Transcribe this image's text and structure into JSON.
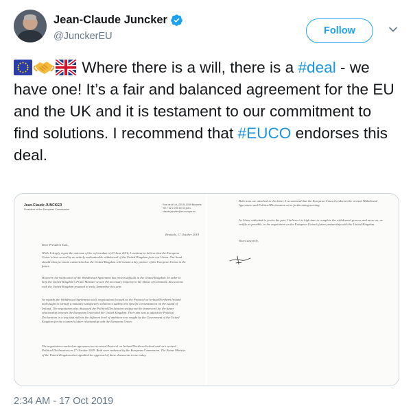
{
  "author": {
    "display_name": "Jean-Claude Juncker",
    "handle": "@JunckerEU",
    "verified": true,
    "avatar_icon": "user-avatar"
  },
  "follow_button": {
    "label": "Follow"
  },
  "menu_icon": "chevron-down-icon",
  "tweet": {
    "emojis": [
      "eu-flag",
      "handshake",
      "uk-flag"
    ],
    "text_1": " Where there is a will, there is a ",
    "hashtag_deal": "#deal",
    "text_2": " - we have one! It’s a fair and balanced agreement for the EU and the UK and it is testament to our commitment to find solutions. I recommend that ",
    "hashtag_euco": "#EUCO",
    "text_3": " endorses this deal."
  },
  "media": {
    "letter_left": {
      "sender": "Jean-Claude JUNCKER",
      "sender_title": "President of the European Commission",
      "address": "Rue de la Loi, 200 B-1049 Brussels Tel. +32 2 295 50 33 jean-claude.juncker@ec.europa.eu",
      "date": "Brussels, 17 October 2019",
      "salutation": "Dear President Tusk,",
      "paragraphs": [
        "While I deeply regret the outcome of the referendum of 23 June 2016, I continue to believe that the European Union is best served by an orderly and amicable withdrawal of the United Kingdom from our Union. Our hand should always remain outstretched as the United Kingdom will remain a key partner of the European Union in the future.",
        "However, the ratification of the Withdrawal Agreement has proven difficult in the United Kingdom. In order to help the United Kingdom’s Prime Minister secure the necessary majority in the House of Commons, discussions with the United Kingdom resumed in early September this year.",
        "As regards the Withdrawal Agreement itself, negotiations focused on the Protocol on Ireland/Northern Ireland and sought to identify a mutually satisfactory solution to address the specific circumstances on the island of Ireland. The negotiators also discussed the Political Declaration setting out the framework for the future relationship between the European Union and the United Kingdom. Their aim was to adjust the Political Declaration in a way that reflects the different level of ambition now sought by the Government of the United Kingdom for the country’s future relationship with the European Union.",
        "The negotiators reached an agreement on a revised Protocol on Ireland/Northern Ireland and on a revised Political Declaration on 17 October 2019. Both were endorsed by the European Commission. The Prime Minister of the United Kingdom also signalled his approval of these documents to me today."
      ]
    },
    "letter_right": {
      "paragraphs": [
        "Both texts are attached to this letter. I recommend that the European Council endorses the revised Withdrawal Agreement and Political Declaration at its forthcoming meeting.",
        "As I have indicated to you in the past, I believe it is high time to complete the withdrawal process and move on, as swiftly as possible, to the negotiation on the European Union’s future partnership with the United Kingdom."
      ],
      "closing": "Yours sincerely,"
    }
  },
  "timestamp": "2:34 AM - 17 Oct 2019",
  "colors": {
    "link": "#1b95e0",
    "follow": "#1da1f2",
    "muted": "#657786",
    "text": "#14171a"
  }
}
